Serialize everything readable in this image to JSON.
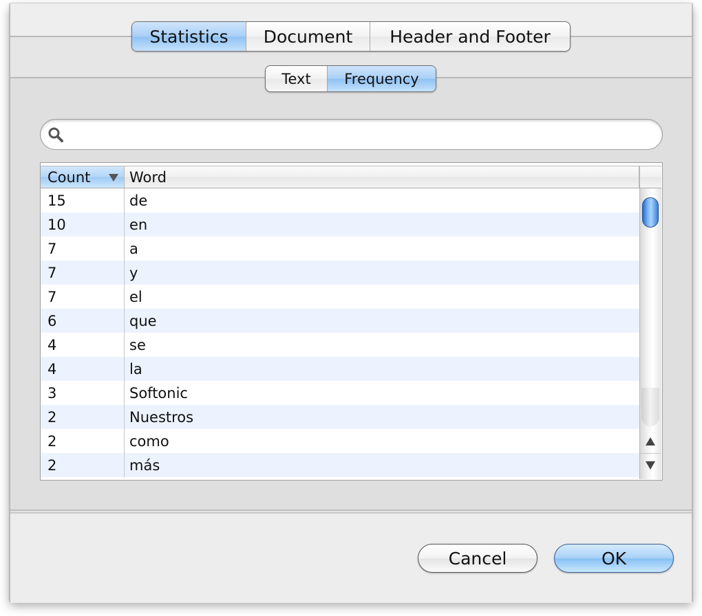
{
  "main_tabs": [
    {
      "label": "Statistics",
      "active": true
    },
    {
      "label": "Document",
      "active": false
    },
    {
      "label": "Header and Footer",
      "active": false
    }
  ],
  "sub_tabs": [
    {
      "label": "Text",
      "active": false
    },
    {
      "label": "Frequency",
      "active": true
    }
  ],
  "search": {
    "value": "",
    "placeholder": "",
    "icon": "search-icon"
  },
  "table": {
    "columns": [
      {
        "label": "Count",
        "sorted": "descending"
      },
      {
        "label": "Word"
      }
    ],
    "rows": [
      {
        "count": "15",
        "word": "de"
      },
      {
        "count": "10",
        "word": "en"
      },
      {
        "count": "7",
        "word": "a"
      },
      {
        "count": "7",
        "word": "y"
      },
      {
        "count": "7",
        "word": "el"
      },
      {
        "count": "6",
        "word": "que"
      },
      {
        "count": "4",
        "word": "se"
      },
      {
        "count": "4",
        "word": "la"
      },
      {
        "count": "3",
        "word": "Softonic"
      },
      {
        "count": "2",
        "word": "Nuestros"
      },
      {
        "count": "2",
        "word": "como"
      },
      {
        "count": "2",
        "word": "más"
      }
    ],
    "scroll_position": 0
  },
  "buttons": {
    "cancel": "Cancel",
    "ok": "OK"
  },
  "colors": {
    "accent": "#a9d0f6",
    "row_alt": "#edf3fe"
  }
}
